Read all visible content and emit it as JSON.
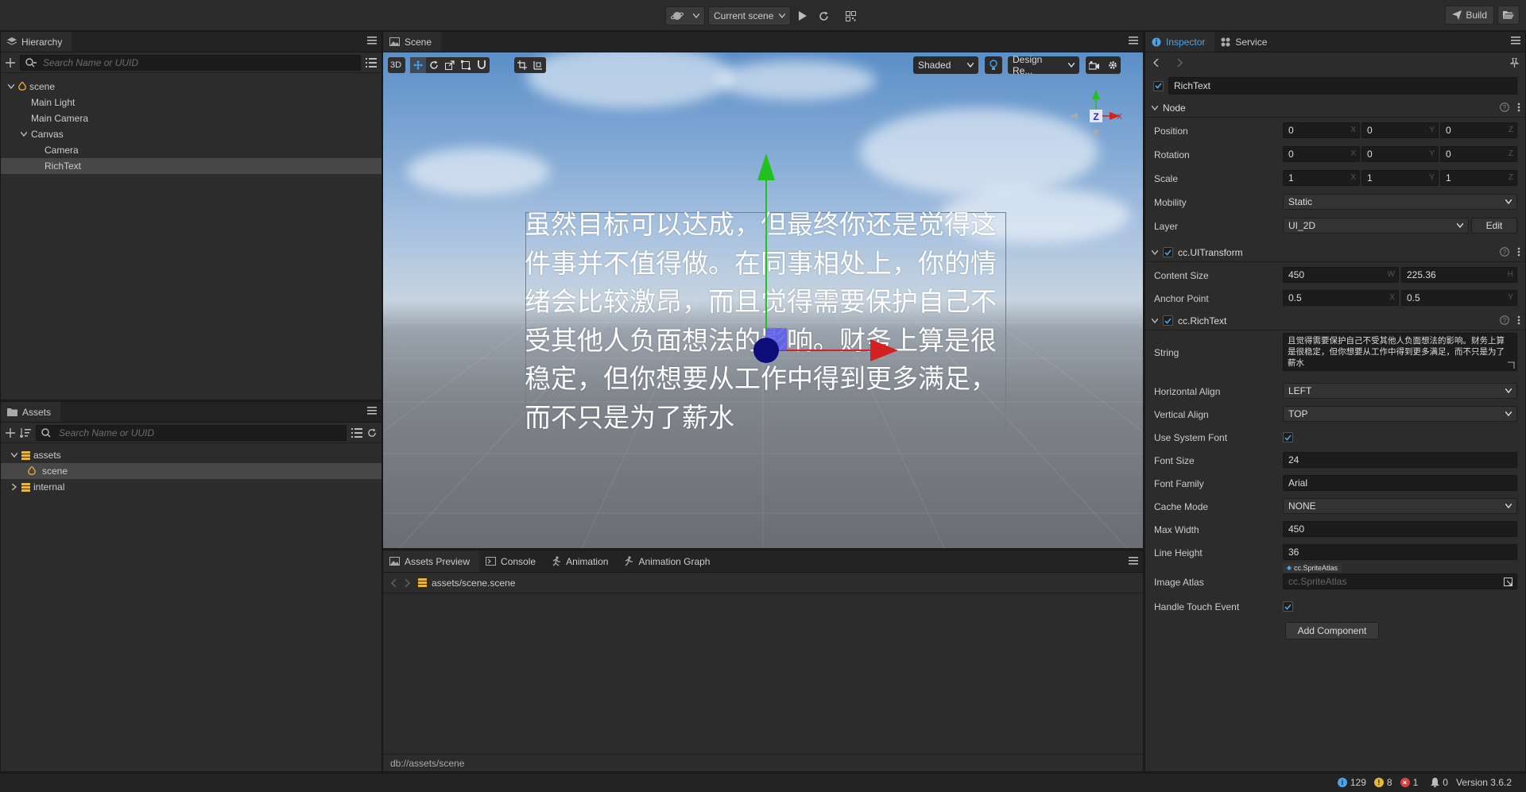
{
  "toolbar": {
    "scene_select": "Current scene",
    "build_label": "Build"
  },
  "hierarchy": {
    "tab": "Hierarchy",
    "search_placeholder": "Search Name or UUID",
    "nodes": [
      "scene",
      "Main Light",
      "Main Camera",
      "Canvas",
      "Camera",
      "RichText"
    ]
  },
  "assets": {
    "tab": "Assets",
    "search_placeholder": "Search Name or UUID",
    "items": [
      "assets",
      "scene",
      "internal"
    ]
  },
  "scene": {
    "tab": "Scene",
    "mode_3d": "3D",
    "shading": "Shaded",
    "design_resolution": "Design Re...",
    "rich_text": "虽然目标可以达成，但最终你还是觉得这件事并不值得做。在同事相处上，你的情绪会比较激昂，而且觉得需要保护自己不受其他人负面想法的影响。财务上算是很稳定，但你想要从工作中得到更多满足，而不只是为了薪水",
    "gizmo_z": "Z",
    "gizmo_x": "X",
    "colors": {
      "axis_y": "#22c122",
      "axis_x": "#d42020",
      "selection": "#3a8bd6"
    }
  },
  "bottom_panel": {
    "tabs": [
      "Assets Preview",
      "Console",
      "Animation",
      "Animation Graph"
    ],
    "path_root": "assets",
    "path_sep": "/",
    "path_file": "scene.scene",
    "status_path": "db://assets/scene"
  },
  "inspector": {
    "tabs": [
      "Inspector",
      "Service"
    ],
    "node_name": "RichText",
    "node_section": "Node",
    "position_label": "Position",
    "position": [
      "0",
      "0",
      "0"
    ],
    "rotation_label": "Rotation",
    "rotation": [
      "0",
      "0",
      "0"
    ],
    "scale_label": "Scale",
    "scale": [
      "1",
      "1",
      "1"
    ],
    "axes": [
      "X",
      "Y",
      "Z"
    ],
    "mobility_label": "Mobility",
    "mobility": "Static",
    "layer_label": "Layer",
    "layer": "UI_2D",
    "edit_label": "Edit",
    "uitransform_title": "cc.UITransform",
    "content_size_label": "Content Size",
    "content_size": [
      "450",
      "225.36"
    ],
    "size_axes": [
      "W",
      "H"
    ],
    "anchor_label": "Anchor Point",
    "anchor": [
      "0.5",
      "0.5"
    ],
    "richtext_title": "cc.RichText",
    "string_label": "String",
    "string_value": "且觉得需要保护自己不受其他人负面想法的影响。财务上算是很稳定，但你想要从工作中得到更多满足，而不只是为了薪水",
    "halign_label": "Horizontal Align",
    "halign": "LEFT",
    "valign_label": "Vertical Align",
    "valign": "TOP",
    "use_system_font_label": "Use System Font",
    "font_size_label": "Font Size",
    "font_size": "24",
    "font_family_label": "Font Family",
    "font_family": "Arial",
    "cache_mode_label": "Cache Mode",
    "cache_mode": "NONE",
    "max_width_label": "Max Width",
    "max_width": "450",
    "line_height_label": "Line Height",
    "line_height": "36",
    "image_atlas_label": "Image Atlas",
    "image_atlas_tag": "cc.SpriteAtlas",
    "image_atlas_placeholder": "cc.SpriteAtlas",
    "handle_touch_label": "Handle Touch Event",
    "add_component": "Add Component"
  },
  "status": {
    "info_count": "129",
    "warn_count": "8",
    "error_count": "1",
    "notify_count": "0",
    "version": "Version 3.6.2"
  },
  "accent_color": "#4ba3e8"
}
